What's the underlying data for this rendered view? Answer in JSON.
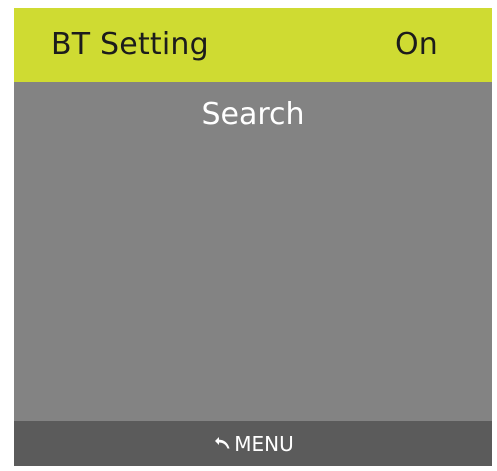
{
  "colors": {
    "header_bg": "#cfdb32",
    "screen_bg": "#838383",
    "footer_bg": "#5b5b5b",
    "text_dark": "#1c1c1c",
    "text_light": "#ffffff"
  },
  "header": {
    "title": "BT  Setting",
    "status": "On"
  },
  "menu": {
    "items": [
      {
        "label": "Search"
      }
    ]
  },
  "footer": {
    "icon": "back-arrow-icon",
    "label": "MENU"
  }
}
